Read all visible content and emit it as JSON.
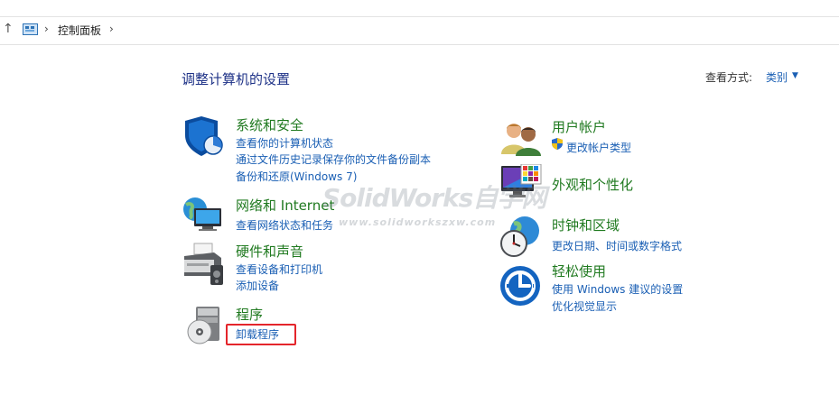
{
  "breadcrumb": {
    "up_icon": "arrow-up-icon",
    "location_icon": "control-panel-icon",
    "items": [
      "控制面板"
    ]
  },
  "page": {
    "title": "调整计算机的设置",
    "view_by_label": "查看方式:",
    "view_by_value": "类别"
  },
  "categories": {
    "security": {
      "icon": "shield-icon",
      "title": "系统和安全",
      "links": [
        "查看你的计算机状态",
        "通过文件历史记录保存你的文件备份副本",
        "备份和还原(Windows 7)"
      ]
    },
    "network": {
      "icon": "network-globe-icon",
      "title": "网络和 Internet",
      "links": [
        "查看网络状态和任务"
      ]
    },
    "hardware": {
      "icon": "printer-icon",
      "title": "硬件和声音",
      "links": [
        "查看设备和打印机",
        "添加设备"
      ]
    },
    "programs": {
      "icon": "programs-disc-icon",
      "title": "程序",
      "links": [
        "卸载程序"
      ]
    },
    "accounts": {
      "icon": "users-icon",
      "title": "用户帐户",
      "links": [
        "更改帐户类型"
      ],
      "link_icon": "uac-shield-icon"
    },
    "appearance": {
      "icon": "display-palette-icon",
      "title": "外观和个性化",
      "links": []
    },
    "clock": {
      "icon": "clock-globe-icon",
      "title": "时钟和区域",
      "links": [
        "更改日期、时间或数字格式"
      ]
    },
    "ease": {
      "icon": "ease-of-access-icon",
      "title": "轻松使用",
      "links": [
        "使用 Windows 建议的设置",
        "优化视觉显示"
      ]
    }
  },
  "watermark": {
    "main": "SolidWorks自学网",
    "sub": "www.solidworkszxw.com"
  },
  "colors": {
    "title_blue": "#1e3287",
    "category_green": "#207a20",
    "link_blue": "#1a5fb4",
    "highlight_red": "#e4252b"
  }
}
